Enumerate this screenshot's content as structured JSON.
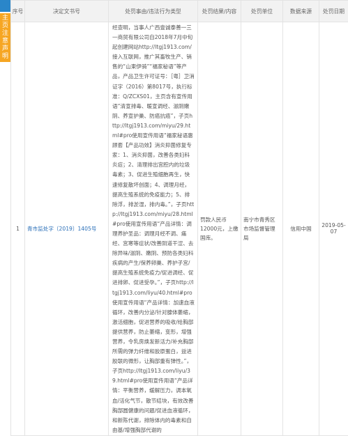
{
  "side_tab": {
    "lines": [
      "注",
      "意",
      "声",
      "声",
      "明"
    ],
    "badge_lines": [
      "主",
      "页"
    ]
  },
  "table": {
    "headers": [
      "序号",
      "决定文书号",
      "处罚事由/违法行为类型",
      "处罚结果/内容",
      "处罚单位",
      "数据来源",
      "处罚日期"
    ],
    "row": {
      "index": "1",
      "doc_number": "青市监处字〔2019〕1405号",
      "violation": "经查明，当事人广西壹诚泰善一三一商贸有限公司自2018年7月中旬起创建网站http://ltgj1913.com/接入互联网，推广其畜牧生产、销售的“山柬伊骑”“福家秘语”等产品，产品卫生许可证号：［粤］卫消证字（2016）第8017号，执行标准：Q/ZCXS01，主页含有宣传用语“清宣排毒、暖宣调经、滋阴嫩阴、养宣护巢、防癌抗癌”，子页http://ltgj1913.com/miyu/29.html#pro使用宣传用语“福家秘语惠顾套【产品功效】消炎抑菌修复专家：1、消炎抑菌，改善各类妇科炎症；2、清理排出宫腔内的垃圾毒素；3、促进生殖细胞再生，快速修复散坏创面；4、调理月经，提高生殖系统的免疫能力；5、排除浮，排淤湿，排内毒。”，子页http://ltgj1913.com/miyu/28.html#pro使用宣传用语“产品详情：调理养护圣品：调理月经不调、痛经、宫寒等症状/改善阴道干涩、去除异味/滋阴、嫩阴、预防各类妇科疾病的产生/保养卵巢、养护子宫/提高生殖系统免疫力/促进调经、促进排卵、促进受孕。”，子页http://ltgj1913.com/liyu/40.html#pro使用宣传用语“产品详情：加速血液循环，改善内分泌/针对腺体萎缩，激活细胞，促进营养的吸收/给胸部提供营养，防止萎缩，变形，增强营养，令乳房焕发新活力/补充胸部所需的弹力纤维和胶原蛋白，益进胶联的微形，让胸部重有弹性。”，子页http://ltgj1913.com/liyu/39.html#pro使用宣传用语“产品详情：平衡营养，缓解压力，调本氧血/活化气节，散节结块，有效改善胸部圆健康的问题/促进血液循环，和新陈代谢，排除体内的毒素和自由基/增强胸部代谢的",
      "result": "罚款人民币12000元，上缴国库。",
      "unit": "南宁市青秀区市场监督管理局",
      "source": "信用中国",
      "date": "2019-05-07"
    }
  },
  "colors": {
    "header_bg": "#f2f2f2",
    "border": "#e3e3e3",
    "link": "#2a6fb8",
    "side_badge": "#2a86c9",
    "side_tab": "#f6a623"
  }
}
